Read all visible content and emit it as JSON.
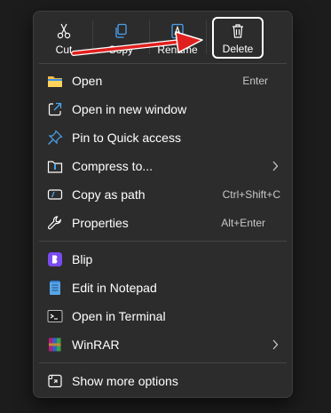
{
  "toolbar": {
    "cut": "Cut",
    "copy": "Copy",
    "rename": "Rename",
    "delete": "Delete"
  },
  "items": {
    "open": {
      "label": "Open",
      "shortcut": "Enter"
    },
    "open_new_window": {
      "label": "Open in new window"
    },
    "pin_quick_access": {
      "label": "Pin to Quick access"
    },
    "compress": {
      "label": "Compress to..."
    },
    "copy_path": {
      "label": "Copy as path",
      "shortcut": "Ctrl+Shift+C"
    },
    "properties": {
      "label": "Properties",
      "shortcut": "Alt+Enter"
    },
    "blip": {
      "label": "Blip"
    },
    "notepad": {
      "label": "Edit in Notepad"
    },
    "terminal": {
      "label": "Open in Terminal"
    },
    "winrar": {
      "label": "WinRAR"
    },
    "more_options": {
      "label": "Show more options"
    }
  },
  "colors": {
    "background": "#1c1c1c",
    "menu": "#2c2c2c",
    "annotation_arrow": "#e0201e",
    "accent_blue": "#4aa3f0",
    "blip_purple": "#7a4cf0"
  }
}
